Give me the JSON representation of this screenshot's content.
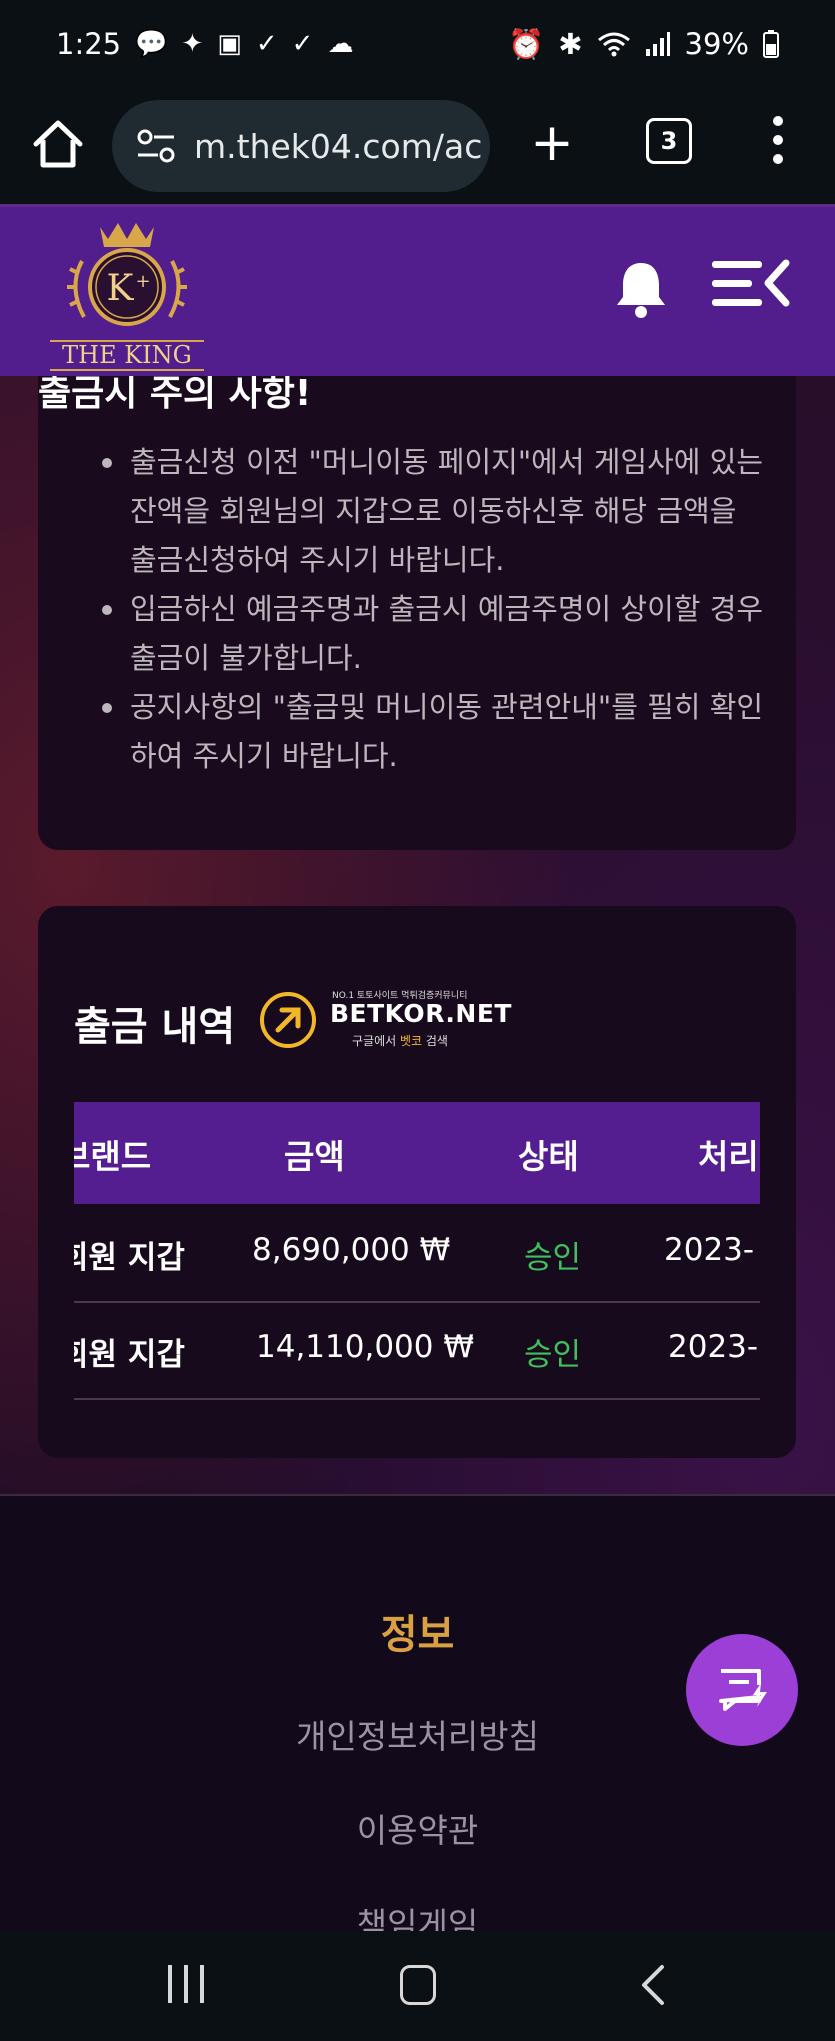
{
  "status_bar": {
    "time": "1:25",
    "notification_icons": [
      "chat-bubble-icon",
      "app-icon",
      "image-icon",
      "check-icon",
      "check-icon",
      "cloud-icon"
    ],
    "battery": "39%",
    "system_icons": [
      "alarm-icon",
      "bluetooth-icon",
      "wifi-icon",
      "signal-icon",
      "battery-icon"
    ]
  },
  "browser": {
    "url": "m.thek04.com/ac",
    "tab_count": "3"
  },
  "header": {
    "logo_text": "THE KING",
    "logo_monogram": "K"
  },
  "notice": {
    "title": "출금시 주의 사항!",
    "items": [
      "출금신청 이전 \"머니이동 페이지\"에서 게임사에 있는 잔액을 회원님의 지갑으로 이동하신후 해당 금액을 출금신청하여 주시기 바랍니다.",
      "입금하신 예금주명과 출금시 예금주명이 상이할 경우 출금이 불가합니다.",
      "공지사항의 \"출금및 머니이동 관련안내\"를 필히 확인하여 주시기 바랍니다."
    ]
  },
  "history": {
    "title": "출금 내역",
    "watermark": {
      "top": "NO.1 토토사이트 먹튀검증커뮤니티",
      "name": "BETKOR.NET",
      "sub_prefix": "구글에서 ",
      "sub_highlight": "벳코",
      "sub_suffix": " 검색"
    },
    "columns": [
      "브랜드",
      "금액",
      "상태",
      "처리"
    ],
    "rows": [
      {
        "brand": "회원 지갑",
        "amount": "8,690,000 ₩",
        "status": "승인",
        "date": "2023-"
      },
      {
        "brand": "회원 지갑",
        "amount": "14,110,000 ₩",
        "status": "승인",
        "date": "2023-"
      }
    ]
  },
  "footer": {
    "title": "정보",
    "links": [
      "개인정보처리방침",
      "이용약관",
      "책임게임"
    ]
  },
  "colors": {
    "header_purple": "#521d8c",
    "table_header": "#541d90",
    "status_green": "#3fbf5e",
    "info_gold": "#d9a142",
    "fab": "#9b3fd6"
  }
}
